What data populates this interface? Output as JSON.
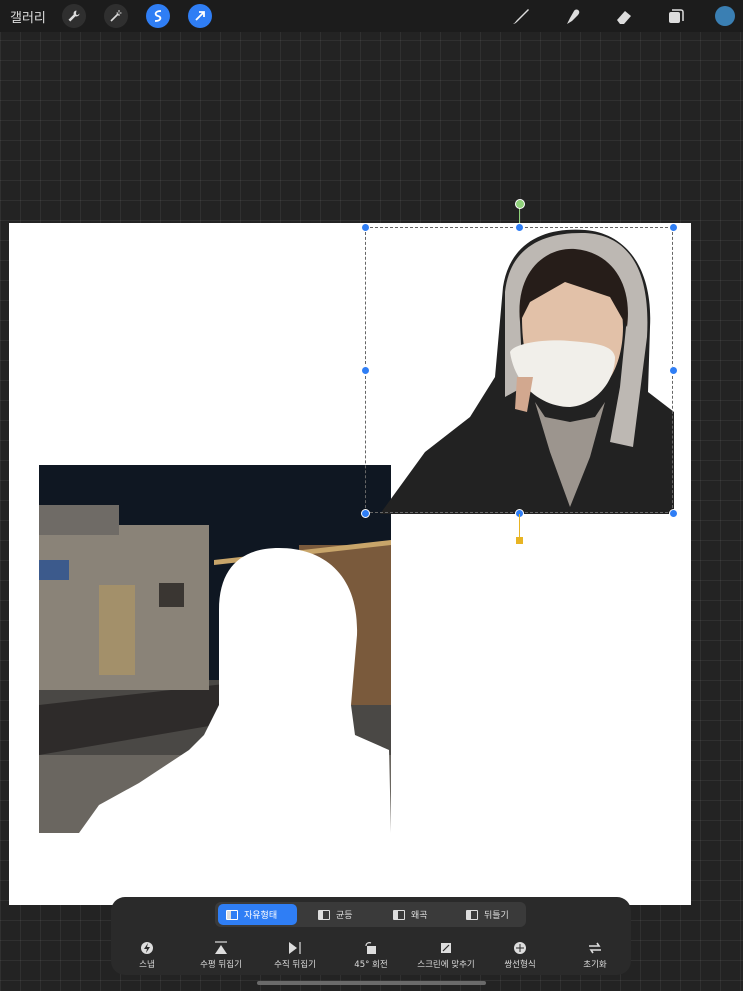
{
  "topbar": {
    "gallery_label": "갤러리",
    "left_icons": [
      "wrench-icon",
      "magic-wand-icon",
      "selection-icon",
      "transform-arrow-icon"
    ],
    "right_icons": [
      "brush-icon",
      "smudge-icon",
      "eraser-icon",
      "layers-icon"
    ],
    "color": "#3a7fb3"
  },
  "canvas": {
    "background": "#ffffff"
  },
  "transform_modes": [
    {
      "label": "자유형태",
      "active": true
    },
    {
      "label": "균등",
      "active": false
    },
    {
      "label": "왜곡",
      "active": false
    },
    {
      "label": "뒤틀기",
      "active": false
    }
  ],
  "tools": [
    {
      "label": "스냅",
      "icon": "snap-icon"
    },
    {
      "label": "수평 뒤집기",
      "icon": "flip-horizontal-icon"
    },
    {
      "label": "수직 뒤집기",
      "icon": "flip-vertical-icon"
    },
    {
      "label": "45° 회전",
      "icon": "rotate-icon"
    },
    {
      "label": "스크린에 맞추기",
      "icon": "fit-screen-icon"
    },
    {
      "label": "쌍선형식",
      "icon": "interpolation-icon"
    },
    {
      "label": "초기화",
      "icon": "reset-icon"
    }
  ],
  "accent": "#2f7ef5"
}
